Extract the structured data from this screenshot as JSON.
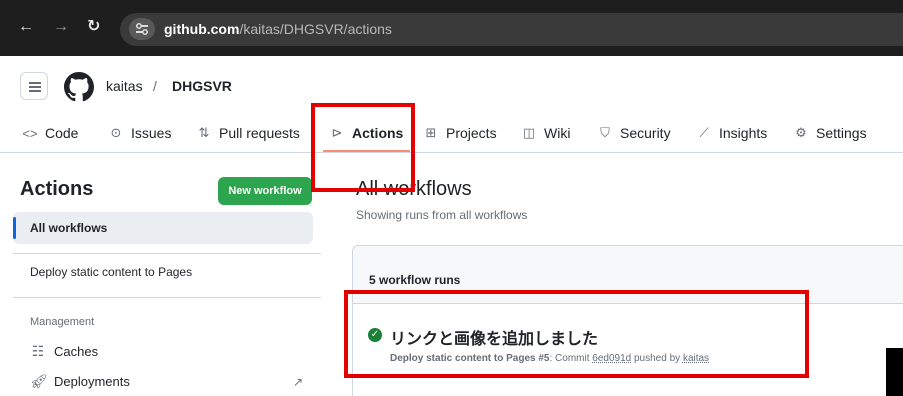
{
  "browser": {
    "url_host": "github.com",
    "url_path": "/kaitas/DHGSVR/actions",
    "back_icon": "arrow-left-icon",
    "forward_icon": "arrow-right-icon",
    "reload_icon": "reload-icon"
  },
  "repo": {
    "owner": "kaitas",
    "separator": "/",
    "name": "DHGSVR"
  },
  "tabs": [
    {
      "label": "Code",
      "icon": "code-icon"
    },
    {
      "label": "Issues",
      "icon": "issue-circle-icon"
    },
    {
      "label": "Pull requests",
      "icon": "pull-request-icon"
    },
    {
      "label": "Actions",
      "icon": "play-circle-icon",
      "active": true
    },
    {
      "label": "Projects",
      "icon": "table-icon"
    },
    {
      "label": "Wiki",
      "icon": "book-icon"
    },
    {
      "label": "Security",
      "icon": "shield-icon"
    },
    {
      "label": "Insights",
      "icon": "graph-icon"
    },
    {
      "label": "Settings",
      "icon": "gear-icon"
    }
  ],
  "sidebar": {
    "title": "Actions",
    "new_workflow": "New workflow",
    "items": [
      {
        "label": "All workflows",
        "selected": true
      },
      {
        "label": "Deploy static content to Pages"
      }
    ],
    "management_heading": "Management",
    "management_links": [
      {
        "label": "Caches",
        "icon": "cache-icon"
      },
      {
        "label": "Deployments",
        "icon": "rocket-icon",
        "external_icon": "external-link-icon"
      }
    ]
  },
  "main": {
    "title": "All workflows",
    "subtitle": "Showing runs from all workflows",
    "runs_count": "5 workflow runs",
    "runs": [
      {
        "status": "success",
        "title": "リンクと画像を追加しました",
        "workflow": "Deploy static content to Pages #5",
        "commit_prefix": ": Commit ",
        "commit_sha": "6ed091d",
        "pushed_by": " pushed by ",
        "actor": "kaitas"
      }
    ]
  },
  "colors": {
    "highlight": "#e30000",
    "primary_button": "#2da44e",
    "active_tab_underline": "#fd8c73",
    "success": "#1a7f37"
  }
}
